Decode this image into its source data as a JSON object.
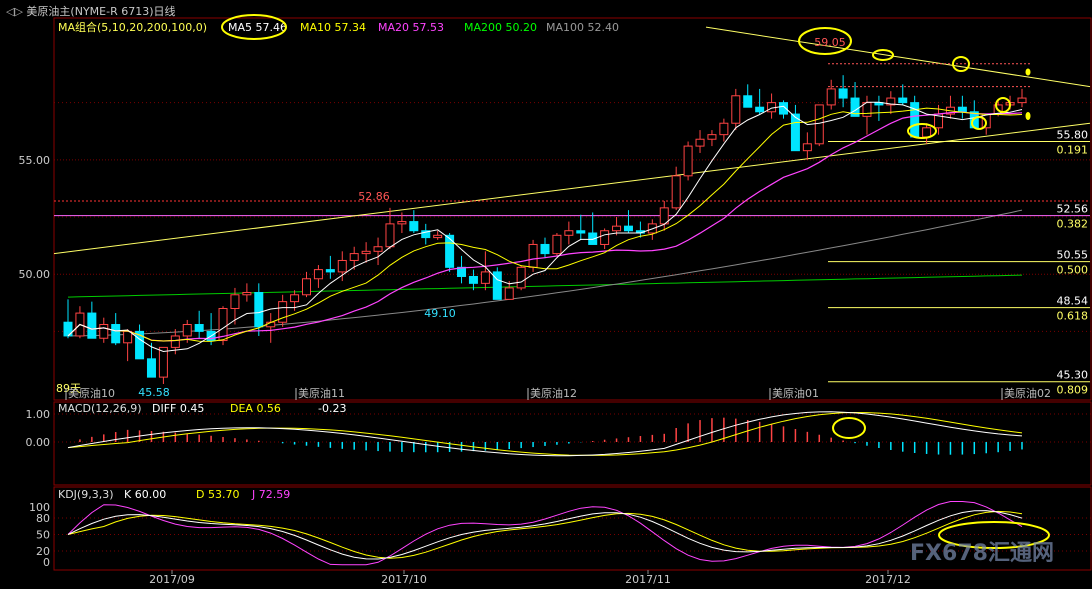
{
  "header": {
    "icon": "chevron-pair-icon",
    "title": "美原油主(NYME-R 6713)日线"
  },
  "ma_legend": [
    {
      "text": "MA组合(5,10,20,200,100,0)",
      "color": "#ffff55"
    },
    {
      "text": "MA5 57.46",
      "color": "#ffffff"
    },
    {
      "text": "MA10 57.34",
      "color": "#ffff00"
    },
    {
      "text": "MA20 57.53",
      "color": "#ff44ff"
    },
    {
      "text": "MA200 50.20",
      "color": "#00ff00"
    },
    {
      "text": "MA100 52.40",
      "color": "#999999"
    }
  ],
  "macd_legend": [
    {
      "text": "MACD(12,26,9)",
      "color": "#dddddd"
    },
    {
      "text": "DIFF  0.45",
      "color": "#ffffff"
    },
    {
      "text": "DEA  0.56",
      "color": "#ffff00"
    },
    {
      "text": "-0.23",
      "color": "#ffffff"
    }
  ],
  "kdj_legend": [
    {
      "text": "KDJ(9,3,3)",
      "color": "#dddddd"
    },
    {
      "text": "K  60.00",
      "color": "#ffffff"
    },
    {
      "text": "D  53.70",
      "color": "#ffff00"
    },
    {
      "text": "J  72.59",
      "color": "#ff44ff"
    }
  ],
  "price_axis": {
    "ticks": [
      "55.00",
      "50.00"
    ]
  },
  "macd_axis": {
    "ticks": [
      "1.00",
      "0.00"
    ]
  },
  "kdj_axis": {
    "ticks": [
      "100",
      "80",
      "50",
      "20",
      "0"
    ]
  },
  "date_axis": [
    "2017/09",
    "2017/10",
    "2017/11",
    "2017/12"
  ],
  "contract_labels": [
    "美原油10",
    "美原油11",
    "美原油12",
    "美原油01",
    "美原油02"
  ],
  "price_annotations": {
    "high_1": "52.86",
    "low_1": "49.10",
    "low_start": "45.58",
    "high_2": "59.05",
    "days": "89天"
  },
  "fib_levels": [
    {
      "price": "55.80",
      "ratio": "0.191"
    },
    {
      "price": "52.56",
      "ratio": "0.382"
    },
    {
      "price": "50.55",
      "ratio": "0.500"
    },
    {
      "price": "48.54",
      "ratio": "0.618"
    },
    {
      "price": "45.30",
      "ratio": "0.809"
    }
  ],
  "watermark": "FX678汇通网",
  "colors": {
    "up": "#ff4444",
    "down": "#00e5ff",
    "ma5": "#ffffff",
    "ma10": "#ffff00",
    "ma20": "#ff44ff",
    "ma200": "#00cc00",
    "ma100": "#888888",
    "trend": "#ffff66",
    "highlight": "#ffff00",
    "grid": "#7a0000"
  },
  "chart_data": {
    "type": "candlestick",
    "x": [
      "2017/08/31",
      "2017/09/01",
      "2017/09/05",
      "2017/09/06",
      "2017/09/07",
      "2017/09/08",
      "2017/09/11",
      "2017/09/12",
      "2017/09/13",
      "2017/09/14",
      "2017/09/15",
      "2017/09/18",
      "2017/09/19",
      "2017/09/20",
      "2017/09/21",
      "2017/09/22",
      "2017/09/25",
      "2017/09/26",
      "2017/09/27",
      "2017/09/28",
      "2017/09/29",
      "2017/10/02",
      "2017/10/03",
      "2017/10/04",
      "2017/10/05",
      "2017/10/06",
      "2017/10/09",
      "2017/10/10",
      "2017/10/11",
      "2017/10/12",
      "2017/10/13",
      "2017/10/16",
      "2017/10/17",
      "2017/10/18",
      "2017/10/19",
      "2017/10/20",
      "2017/10/23",
      "2017/10/24",
      "2017/10/25",
      "2017/10/26",
      "2017/10/27",
      "2017/10/30",
      "2017/10/31",
      "2017/11/01",
      "2017/11/02",
      "2017/11/03",
      "2017/11/06",
      "2017/11/07",
      "2017/11/08",
      "2017/11/09",
      "2017/11/10",
      "2017/11/13",
      "2017/11/14",
      "2017/11/15",
      "2017/11/16",
      "2017/11/17",
      "2017/11/20",
      "2017/11/21",
      "2017/11/22",
      "2017/11/24",
      "2017/11/27",
      "2017/11/28",
      "2017/11/29",
      "2017/11/30",
      "2017/12/01",
      "2017/12/04",
      "2017/12/05",
      "2017/12/06",
      "2017/12/07",
      "2017/12/08",
      "2017/12/11",
      "2017/12/12",
      "2017/12/13",
      "2017/12/14",
      "2017/12/15",
      "2017/12/18",
      "2017/12/19",
      "2017/12/20",
      "2017/12/21",
      "2017/12/22",
      "2017/12/26"
    ],
    "ohlc": [
      [
        47.9,
        48.9,
        47.2,
        47.3
      ],
      [
        47.3,
        48.6,
        47.2,
        48.3
      ],
      [
        48.3,
        48.8,
        47.5,
        47.2
      ],
      [
        47.2,
        48.1,
        47.0,
        47.8
      ],
      [
        47.8,
        48.3,
        46.9,
        47.0
      ],
      [
        47.0,
        47.6,
        46.2,
        47.5
      ],
      [
        47.5,
        47.8,
        46.8,
        46.3
      ],
      [
        46.3,
        47.0,
        46.0,
        45.5
      ],
      [
        45.5,
        46.2,
        45.2,
        46.8
      ],
      [
        46.8,
        47.6,
        46.5,
        47.3
      ],
      [
        47.3,
        48.0,
        47.0,
        47.8
      ],
      [
        47.8,
        48.4,
        47.2,
        47.5
      ],
      [
        47.5,
        48.3,
        46.9,
        47.1
      ],
      [
        47.1,
        48.6,
        46.9,
        48.5
      ],
      [
        48.5,
        49.4,
        47.8,
        49.1
      ],
      [
        49.1,
        49.6,
        48.8,
        49.2
      ],
      [
        49.2,
        49.6,
        47.3,
        47.7
      ],
      [
        47.7,
        48.3,
        47.0,
        47.9
      ],
      [
        47.9,
        49.1,
        47.7,
        48.8
      ],
      [
        48.8,
        49.3,
        48.4,
        49.1
      ],
      [
        49.1,
        50.1,
        49.0,
        49.8
      ],
      [
        49.8,
        50.4,
        49.4,
        50.2
      ],
      [
        50.2,
        50.8,
        49.8,
        50.1
      ],
      [
        50.1,
        51.0,
        49.7,
        50.6
      ],
      [
        50.6,
        51.2,
        50.2,
        50.9
      ],
      [
        50.9,
        51.4,
        50.5,
        51.0
      ],
      [
        51.0,
        51.6,
        50.4,
        51.2
      ],
      [
        51.2,
        52.9,
        51.1,
        52.2
      ],
      [
        52.2,
        52.7,
        51.8,
        52.3
      ],
      [
        52.3,
        52.8,
        51.8,
        51.9
      ],
      [
        51.9,
        52.2,
        51.3,
        51.6
      ],
      [
        51.6,
        51.9,
        51.5,
        51.7
      ],
      [
        51.7,
        51.8,
        50.1,
        50.3
      ],
      [
        50.3,
        50.8,
        49.6,
        49.9
      ],
      [
        49.9,
        50.2,
        49.3,
        49.6
      ],
      [
        49.6,
        51.0,
        49.3,
        50.1
      ],
      [
        50.1,
        50.3,
        49.0,
        48.9
      ],
      [
        48.9,
        49.7,
        49.1,
        49.4
      ],
      [
        49.4,
        50.4,
        49.3,
        50.3
      ],
      [
        50.3,
        51.5,
        50.1,
        51.3
      ],
      [
        51.3,
        51.6,
        50.7,
        50.9
      ],
      [
        50.9,
        51.8,
        50.8,
        51.7
      ],
      [
        51.7,
        52.3,
        51.3,
        51.9
      ],
      [
        51.9,
        52.6,
        51.5,
        51.8
      ],
      [
        51.8,
        52.7,
        51.3,
        51.3
      ],
      [
        51.3,
        52.0,
        51.1,
        51.9
      ],
      [
        51.9,
        52.5,
        51.7,
        52.1
      ],
      [
        52.1,
        52.8,
        51.8,
        51.9
      ],
      [
        51.9,
        52.3,
        51.6,
        51.8
      ],
      [
        51.8,
        52.4,
        51.5,
        52.2
      ],
      [
        52.2,
        53.2,
        51.9,
        52.9
      ],
      [
        52.9,
        54.7,
        52.8,
        54.3
      ],
      [
        54.3,
        55.8,
        54.1,
        55.6
      ],
      [
        55.6,
        56.3,
        55.3,
        55.9
      ],
      [
        55.9,
        56.3,
        55.6,
        56.1
      ],
      [
        56.1,
        56.8,
        55.8,
        56.6
      ],
      [
        56.6,
        58.1,
        56.3,
        57.8
      ],
      [
        57.8,
        58.3,
        57.3,
        57.3
      ],
      [
        57.3,
        58.1,
        57.0,
        57.1
      ],
      [
        57.1,
        57.9,
        56.8,
        57.5
      ],
      [
        57.5,
        57.6,
        56.8,
        57.0
      ],
      [
        57.0,
        57.4,
        56.6,
        55.4
      ],
      [
        55.4,
        56.2,
        55.0,
        55.7
      ],
      [
        55.7,
        56.1,
        55.6,
        57.4
      ],
      [
        57.4,
        58.5,
        57.2,
        58.1
      ],
      [
        58.1,
        58.7,
        57.3,
        57.7
      ],
      [
        57.7,
        58.4,
        57.4,
        56.9
      ],
      [
        56.9,
        57.8,
        56.1,
        57.5
      ],
      [
        57.5,
        57.8,
        56.7,
        57.4
      ],
      [
        57.4,
        58.0,
        57.0,
        57.7
      ],
      [
        57.7,
        58.3,
        57.4,
        57.5
      ],
      [
        57.5,
        57.8,
        56.0,
        56.0
      ],
      [
        56.0,
        56.6,
        55.7,
        56.4
      ],
      [
        56.4,
        57.4,
        56.1,
        57.0
      ],
      [
        57.0,
        57.8,
        56.8,
        57.3
      ],
      [
        57.3,
        57.8,
        56.8,
        57.1
      ],
      [
        57.1,
        57.6,
        56.7,
        56.4
      ],
      [
        56.4,
        57.0,
        56.1,
        57.0
      ],
      [
        57.0,
        57.6,
        56.9,
        57.4
      ],
      [
        57.4,
        57.8,
        57.2,
        57.5
      ],
      [
        57.5,
        58.1,
        57.3,
        57.7
      ]
    ],
    "ylim": [
      44.5,
      61.2
    ],
    "annotations": [
      "52.86",
      "49.10",
      "45.58",
      "59.05"
    ]
  }
}
